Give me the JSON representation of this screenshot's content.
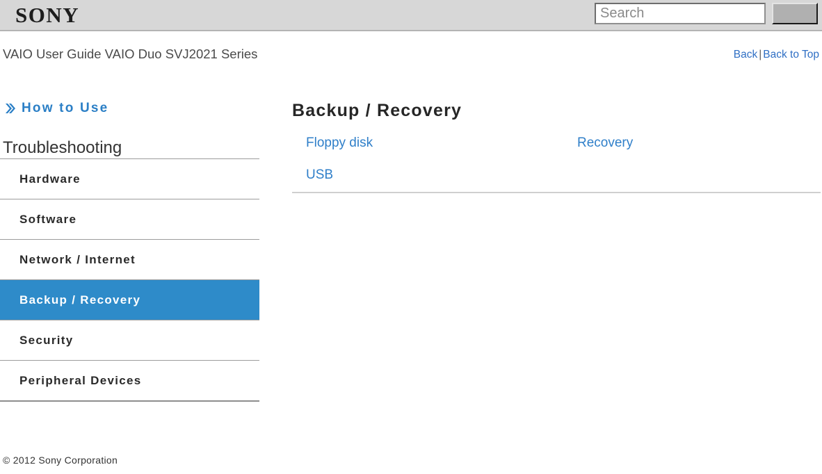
{
  "header": {
    "logo_text": "SONY",
    "search": {
      "placeholder": "Search",
      "value": "",
      "button_label": ""
    }
  },
  "breadcrumb": {
    "guide_title": "VAIO User Guide VAIO Duo SVJ2021 Series",
    "back_label": "Back",
    "separator": "|",
    "back_to_top_label": "Back to Top"
  },
  "sidebar": {
    "how_to_use": {
      "label": "How to Use",
      "icon": "double-chevron-right-icon"
    },
    "section_heading": "Troubleshooting",
    "items": [
      {
        "label": "Hardware",
        "active": false
      },
      {
        "label": "Software",
        "active": false
      },
      {
        "label": "Network / Internet",
        "active": false
      },
      {
        "label": "Backup / Recovery",
        "active": true
      },
      {
        "label": "Security",
        "active": false
      },
      {
        "label": "Peripheral Devices",
        "active": false
      }
    ]
  },
  "main": {
    "title": "Backup / Recovery",
    "columns": [
      {
        "links": [
          "Floppy disk",
          "USB"
        ]
      },
      {
        "links": [
          "Recovery"
        ]
      }
    ]
  },
  "footer": {
    "copyright": "© 2012 Sony Corporation"
  },
  "colors": {
    "accent_blue": "#2e8bc9",
    "link_blue": "#2f7fc9",
    "header_gray": "#d7d7d7",
    "divider_gray": "#9c9c9c"
  }
}
